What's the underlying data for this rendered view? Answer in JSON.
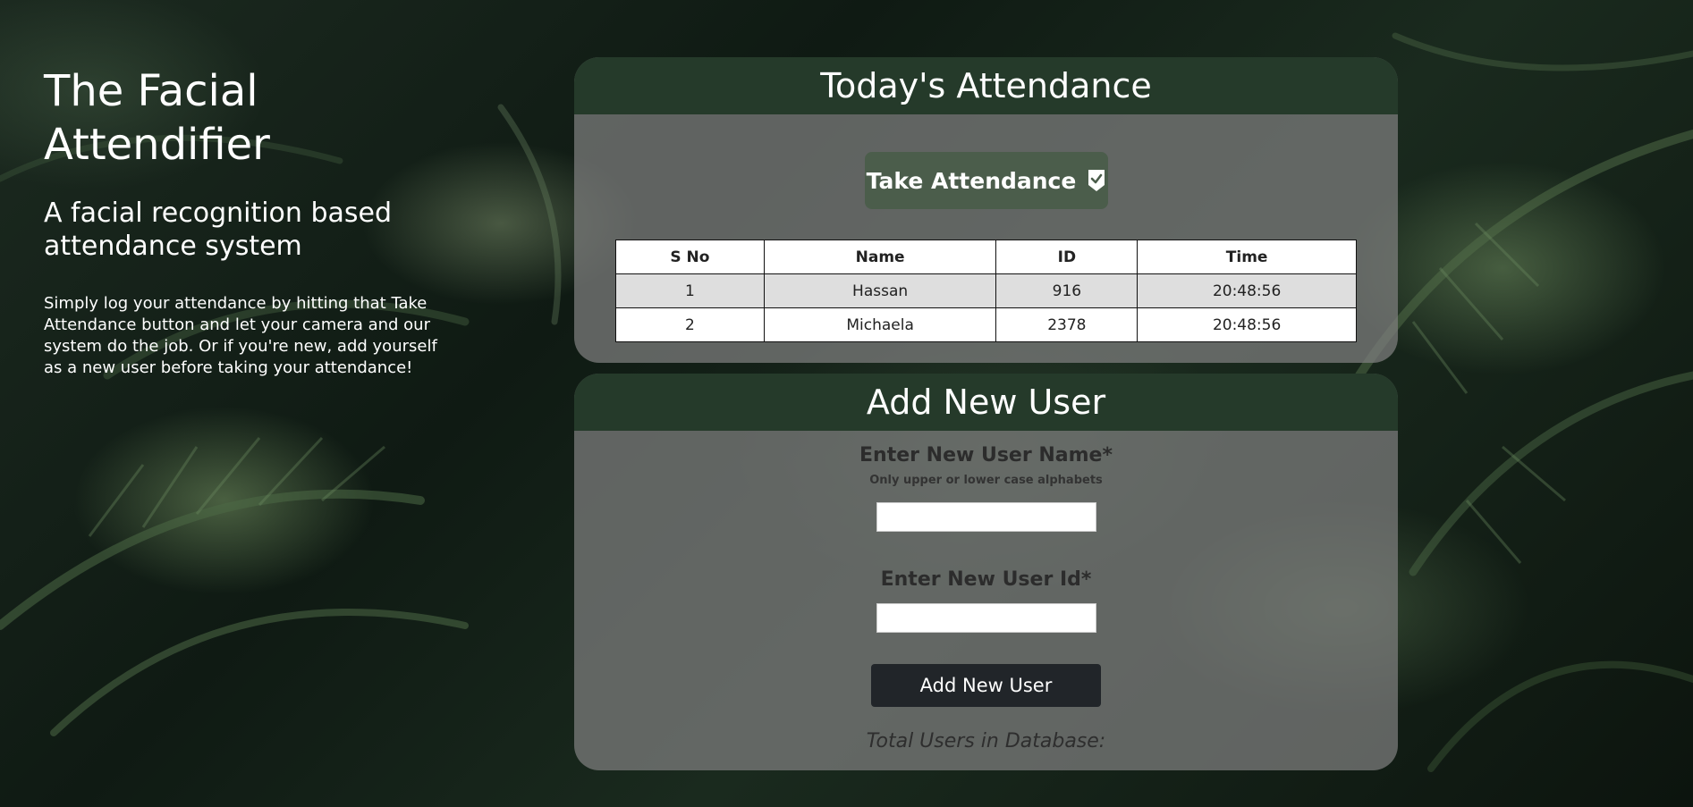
{
  "intro": {
    "title": "The Facial Attendifier",
    "subtitle": "A facial recognition based attendance system",
    "description": "Simply log your attendance by hitting that Take Attendance button and let your camera and our system do the job. Or if you're new, add yourself as a new user before taking your attendance!"
  },
  "attendance": {
    "heading": "Today's Attendance",
    "take_button_label": "Take Attendance",
    "take_button_icon": "check-badge-icon",
    "columns": [
      "S No",
      "Name",
      "ID",
      "Time"
    ],
    "rows": [
      [
        "1",
        "Hassan",
        "916",
        "20:48:56"
      ],
      [
        "2",
        "Michaela",
        "2378",
        "20:48:56"
      ]
    ]
  },
  "add_user": {
    "heading": "Add New User",
    "name_label": "Enter New User Name*",
    "name_hint": "Only upper or lower case alphabets",
    "name_value": "",
    "id_label": "Enter New User Id*",
    "id_value": "",
    "submit_label": "Add New User",
    "total_text": "Total Users in Database:"
  },
  "colors": {
    "header_bg": "#253a2a",
    "take_button_bg": "#4b5d4b",
    "submit_button_bg": "#212529",
    "card_bg": "rgba(128,128,128,0.72)"
  }
}
